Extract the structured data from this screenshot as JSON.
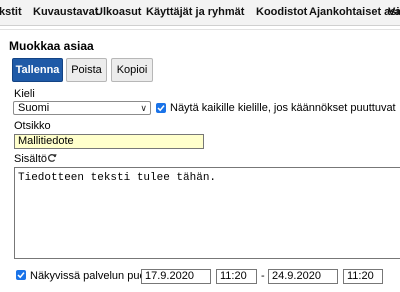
{
  "nav": {
    "items": [
      "kstit",
      "Kuvaustavat",
      "Ulkoasut",
      "Käyttäjät ja ryhmät",
      "Koodistot",
      "Ajankohtaiset asiat",
      "Vas"
    ]
  },
  "page": {
    "title": "Muokkaa asiaa"
  },
  "actions": {
    "save": "Tallenna",
    "delete": "Poista",
    "copy": "Kopioi"
  },
  "language": {
    "label": "Kieli",
    "selected": "Suomi",
    "show_all_label": "Näytä kaikille kielille, jos käännökset puuttuvat",
    "show_all_checked": true
  },
  "title_field": {
    "label": "Otsikko",
    "value": "Mallitiedote"
  },
  "content_field": {
    "label": "Sisältö",
    "value": "Tiedotteen teksti tulee tähän."
  },
  "visibility": {
    "label": "Näkyvissä palvelun puolella",
    "checked": true,
    "start_date": "17.9.2020",
    "start_time": "11:20",
    "separator": "-",
    "end_date": "24.9.2020",
    "end_time": "11:20"
  },
  "colors": {
    "primary": "#1f5aa7",
    "checkbox": "#1a73e8",
    "title_input_bg": "#ffffcc"
  },
  "icons": {
    "refresh": "refresh-icon",
    "dropdown": "chevron-down-icon",
    "check": "check-icon"
  }
}
